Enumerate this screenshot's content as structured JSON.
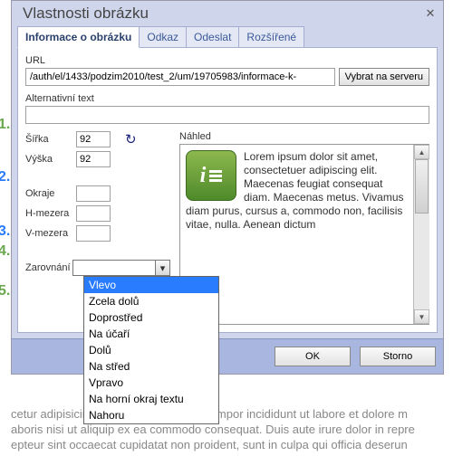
{
  "dialog": {
    "title": "Vlastnosti obrázku",
    "tabs": [
      {
        "label": "Informace o obrázku",
        "active": true
      },
      {
        "label": "Odkaz",
        "active": false
      },
      {
        "label": "Odeslat",
        "active": false
      },
      {
        "label": "Rozšířené",
        "active": false
      }
    ],
    "url": {
      "label": "URL",
      "value": "/auth/el/1433/podzim2010/test_2/um/19705983/informace-k-",
      "browse_button": "Vybrat na serveru"
    },
    "alt": {
      "label": "Alternativní text",
      "value": ""
    },
    "size": {
      "width_label": "Šířka",
      "width_value": "92",
      "height_label": "Výška",
      "height_value": "92"
    },
    "spacing": {
      "border_label": "Okraje",
      "border_value": "",
      "hspace_label": "H-mezera",
      "hspace_value": "",
      "vspace_label": "V-mezera",
      "vspace_value": ""
    },
    "align": {
      "label": "Zarovnání",
      "selected": "Vlevo",
      "options": [
        "Vlevo",
        "Zcela dolů",
        "Doprostřed",
        "Na účaří",
        "Dolů",
        "Na střed",
        "Vpravo",
        "Na horní okraj textu",
        "Nahoru"
      ]
    },
    "preview": {
      "label": "Náhled",
      "text": "Lorem ipsum dolor sit amet, consectetuer adipiscing elit. Maecenas feugiat consequat diam. Maecenas metus. Vivamus diam purus, cursus a, commodo non, facilisis vitae, nulla. Aenean dictum"
    },
    "buttons": {
      "ok": "OK",
      "cancel": "Storno"
    }
  },
  "markers": {
    "m1": "1.",
    "m2": "2.",
    "m3": "3.",
    "m4": "4.",
    "m5": "5."
  },
  "bgtext": "cetur adipisicing elit, sed do eiusmod tempor incididunt ut labore et dolore m aboris nisi ut aliquip ex ea commodo consequat. Duis aute irure dolor in repre epteur sint occaecat cupidatat non proident, sunt in culpa qui officia deserun"
}
